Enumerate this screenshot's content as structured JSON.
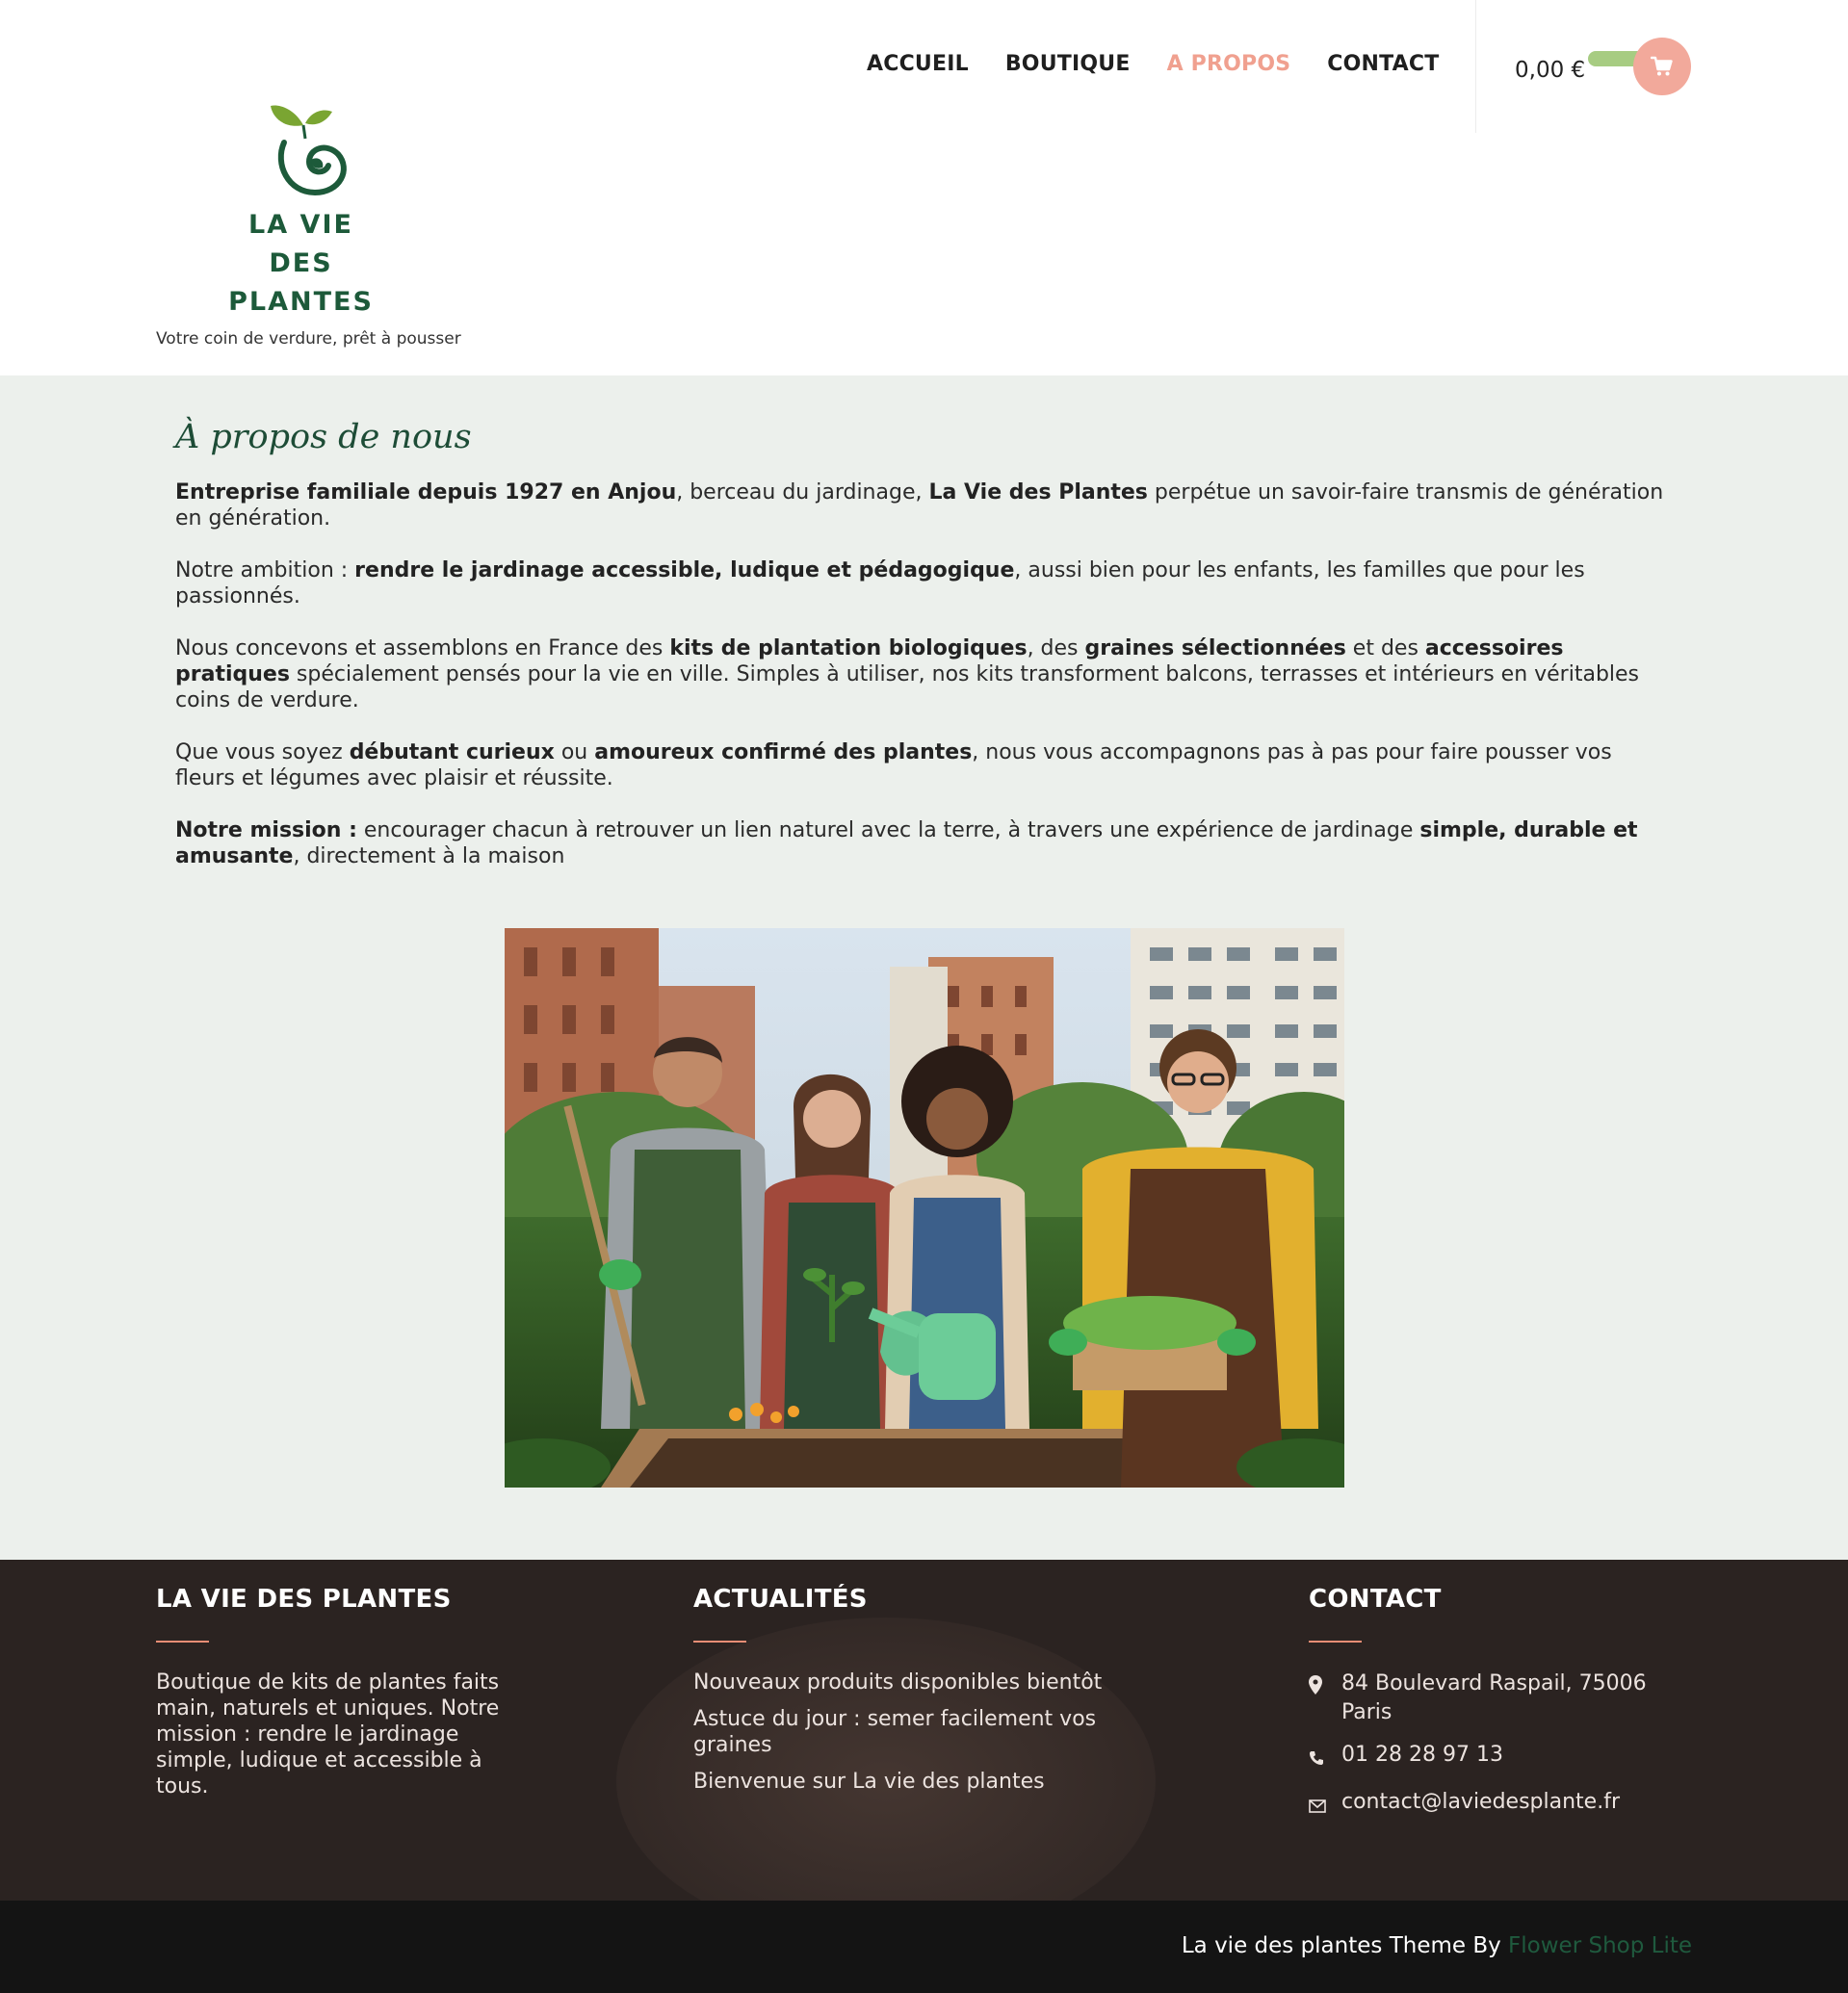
{
  "nav": {
    "items": [
      {
        "label": "ACCUEIL",
        "active": false
      },
      {
        "label": "BOUTIQUE",
        "active": false
      },
      {
        "label": "A PROPOS",
        "active": true
      },
      {
        "label": "CONTACT",
        "active": false
      }
    ]
  },
  "cart": {
    "total": "0,00 €",
    "icon": "shopping-cart-icon"
  },
  "brand": {
    "logo_line1": "LA VIE DES",
    "logo_line2": "PLANTES",
    "tagline": "Votre coin de verdure, prêt à pousser"
  },
  "about": {
    "title": "À propos de nous",
    "p1": {
      "b1": "Entreprise familiale depuis 1927 en Anjou",
      "t1": ", berceau du jardinage, ",
      "b2": "La Vie des Plantes",
      "t2": " perpétue un savoir-faire transmis de génération en génération."
    },
    "p2": {
      "t1": "Notre ambition : ",
      "b1": "rendre le jardinage accessible, ludique et pédagogique",
      "t2": ", aussi bien pour les enfants, les familles que pour les passionnés."
    },
    "p3": {
      "t1": "Nous concevons et assemblons en France des ",
      "b1": "kits de plantation biologiques",
      "t2": ", des ",
      "b2": "graines sélectionnées",
      "t3": " et des ",
      "b3": "accessoires pratiques",
      "t4": " spécialement pensés pour la vie en ville. Simples à utiliser, nos kits transforment balcons, terrasses et intérieurs en véritables coins de verdure."
    },
    "p4": {
      "t1": "Que vous soyez ",
      "b1": "débutant curieux",
      "t2": " ou ",
      "b2": "amoureux confirmé des plantes",
      "t3": ", nous vous accompagnons pas à pas pour faire pousser vos fleurs et légumes avec plaisir et réussite."
    },
    "p5": {
      "b1": "Notre mission :",
      "t1": " encourager chacun à retrouver un lien naturel avec la terre, à travers une expérience de jardinage ",
      "b2": "simple, durable et amusante",
      "t2": ", directement à la maison"
    }
  },
  "footer": {
    "col1": {
      "title": "LA VIE DES PLANTES",
      "text": "Boutique de kits de plantes faits main, naturels et uniques. Notre mission : rendre le jardinage simple, ludique et accessible à tous."
    },
    "col2": {
      "title": "ACTUALITÉS",
      "items": [
        "Nouveaux produits disponibles bientôt",
        "Astuce du jour : semer facilement vos graines",
        "Bienvenue sur La vie des plantes"
      ]
    },
    "col3": {
      "title": "CONTACT",
      "address": "84 Boulevard Raspail, 75006 Paris",
      "phone": "01 28 28 97 13",
      "email": "contact@laviedesplante.fr"
    }
  },
  "credits": {
    "text": "La vie des plantes Theme By ",
    "link": "Flower Shop Lite"
  },
  "colors": {
    "accent": "#f0a08f",
    "brand_green": "#1d5a3a",
    "main_bg": "#ecf0ec",
    "footer_bg": "#2b2321"
  }
}
